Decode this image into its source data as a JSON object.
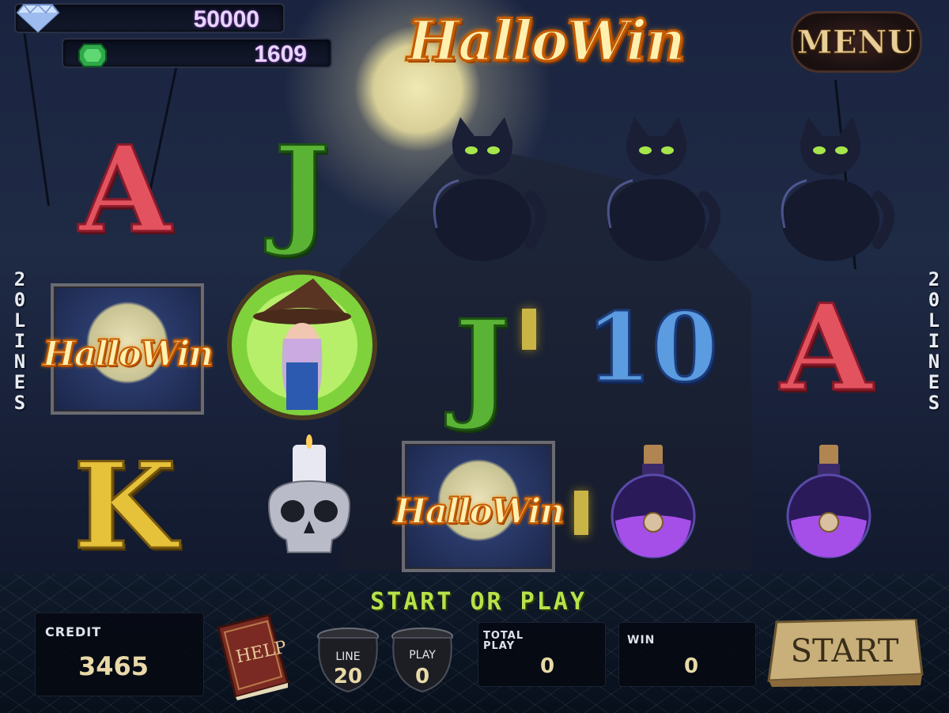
{
  "hud": {
    "diamond_balance": "50000",
    "emerald_balance": "1609"
  },
  "logo": "HalloWin",
  "menu_label": "MENU",
  "lines": {
    "left": [
      "2",
      "0",
      "L",
      "I",
      "N",
      "E",
      "S"
    ],
    "right": [
      "2",
      "0",
      "L",
      "I",
      "N",
      "E",
      "S"
    ]
  },
  "reels": {
    "row1": [
      "A",
      "J",
      "cat",
      "cat",
      "cat"
    ],
    "row2": [
      "HalloWin",
      "witch",
      "J",
      "10",
      "A"
    ],
    "row3": [
      "K",
      "skull-candle",
      "HalloWin",
      "potion",
      "potion"
    ]
  },
  "tile_text": "HalloWin",
  "symbols": {
    "A": "A",
    "J": "J",
    "ten": "10",
    "K": "K"
  },
  "colors": {
    "accent_green": "#b7e24a",
    "logo_orange": "#ff8a00",
    "value_gold": "#e9d9a8"
  },
  "panel": {
    "prompt": "START OR PLAY",
    "credit_label": "CREDIT",
    "credit_value": "3465",
    "help_label": "HELP",
    "line_label": "LINE",
    "line_value": "20",
    "play_label": "PLAY",
    "play_value": "0",
    "total_play_label_1": "TOTAL",
    "total_play_label_2": "PLAY",
    "total_play_value": "0",
    "win_label": "WIN",
    "win_value": "0",
    "start_label": "START"
  }
}
